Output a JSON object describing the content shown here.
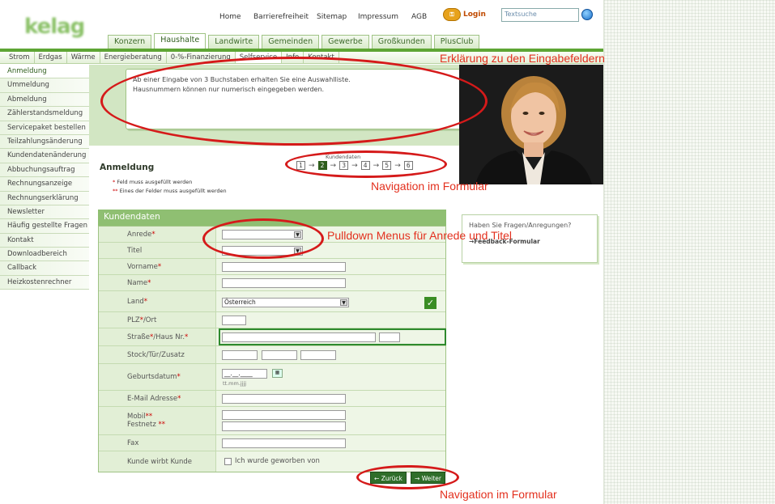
{
  "header": {
    "logo": "kelag",
    "links": [
      "Home",
      "Barrierefreiheit",
      "Sitemap",
      "Impressum",
      "AGB"
    ],
    "login": "Login",
    "search_placeholder": "Textsuche"
  },
  "tabs": [
    "Konzern",
    "Haushalte",
    "Landwirte",
    "Gemeinden",
    "Gewerbe",
    "Großkunden",
    "PlusClub"
  ],
  "active_tab": "Haushalte",
  "subnav": [
    "Strom",
    "Erdgas",
    "Wärme",
    "Energieberatung",
    "0-%-Finanzierung",
    "Selfservice",
    "Info",
    "Kontakt"
  ],
  "sidebar": [
    "Anmeldung",
    "Ummeldung",
    "Abmeldung",
    "Zählerstandsmeldung",
    "Servicepaket bestellen",
    "Teilzahlungsänderung",
    "Kundendatenänderung",
    "Abbuchungsauftrag",
    "Rechnungsanzeige",
    "Rechnungserklärung",
    "Newsletter",
    "Häufig gestellte Fragen",
    "Kontakt",
    "Downloadbereich",
    "Callback",
    "Heizkostenrechner"
  ],
  "infobox": {
    "line1": "Ab einer Eingabe von 3 Buchstaben erhalten Sie eine Auswahlliste.",
    "line2": "Hausnummern können nur numerisch eingegeben werden."
  },
  "page": {
    "title": "Anmeldung",
    "legend1": "Feld muss ausgefüllt werden",
    "legend2": "Eines der Felder muss ausgefüllt werden",
    "req": "*",
    "req2": "**"
  },
  "steps": {
    "label": "Kundendaten",
    "items": [
      "1",
      "2",
      "3",
      "4",
      "5",
      "6"
    ],
    "active": "2"
  },
  "form": {
    "title": "Kundendaten",
    "anrede": "Anrede",
    "titel": "Titel",
    "vorname": "Vorname",
    "name": "Name",
    "land": "Land",
    "land_value": "Österreich",
    "plz": "PLZ",
    "plz_suffix": "/Ort",
    "strasse": "Straße",
    "strasse_suffix": "/Haus Nr.",
    "stock": "Stock/Tür/Zusatz",
    "geburtsdatum": "Geburtsdatum",
    "date_mask": "__.__.____",
    "date_hint": "tt.mm.jjjj",
    "email": "E-Mail Adresse",
    "mobil": "Mobil",
    "festnetz": "Festnetz",
    "fax": "Fax",
    "kwk": "Kunde wirbt Kunde",
    "kwk_checkbox": "Ich wurde geworben von"
  },
  "sidebox": {
    "question": "Haben Sie Fragen/Anregungen?",
    "link": "Feedback-Formular"
  },
  "buttons": {
    "back": "Zurück",
    "next": "Weiter"
  },
  "annotations": {
    "a1": "Erklärung zu den Eingabefeldern",
    "a2": "Navigation im Formular",
    "a3": "Pulldown Menus für Anrede und Titel",
    "a4": "Navigation im Formular"
  }
}
